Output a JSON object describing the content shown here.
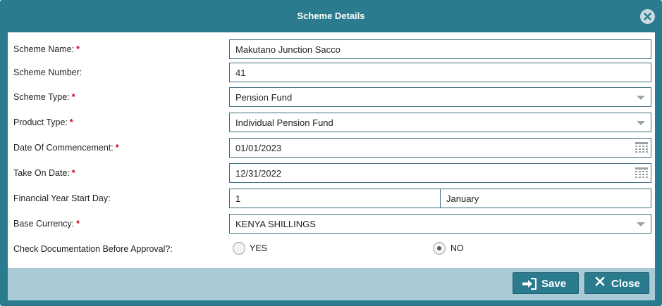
{
  "dialog": {
    "title": "Scheme Details",
    "close_icon": "close-circle-icon"
  },
  "form": {
    "scheme_name": {
      "label": "Scheme Name:",
      "required": "*",
      "value": "Makutano Junction Sacco"
    },
    "scheme_number": {
      "label": "Scheme Number:",
      "value": "41"
    },
    "scheme_type": {
      "label": "Scheme Type:",
      "required": "*",
      "value": "Pension Fund"
    },
    "product_type": {
      "label": "Product Type:",
      "required": "*",
      "value": "Individual Pension Fund"
    },
    "date_of_commencement": {
      "label": "Date Of Commencement:",
      "required": "*",
      "value": "01/01/2023"
    },
    "take_on_date": {
      "label": "Take On Date:",
      "required": "*",
      "value": "12/31/2022"
    },
    "fy_start_day": {
      "label": "Financial Year Start Day:",
      "day": "1",
      "month": "January"
    },
    "base_currency": {
      "label": "Base Currency:",
      "required": "*",
      "value": "KENYA SHILLINGS"
    },
    "check_documentation": {
      "label": "Check Documentation Before Approval?:",
      "options": [
        {
          "label": "YES",
          "selected": false
        },
        {
          "label": "NO",
          "selected": true
        }
      ]
    }
  },
  "footer": {
    "save_label": "Save",
    "close_label": "Close"
  },
  "colors": {
    "header": "#2b7b8e",
    "footer": "#a9cbd5",
    "required": "#d0021b"
  }
}
